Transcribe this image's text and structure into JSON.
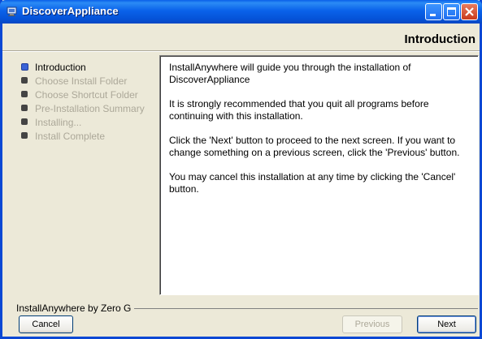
{
  "window": {
    "title": "DiscoverAppliance"
  },
  "page": {
    "heading": "Introduction"
  },
  "steps": [
    {
      "label": "Introduction",
      "active": true
    },
    {
      "label": "Choose Install Folder",
      "active": false
    },
    {
      "label": "Choose Shortcut Folder",
      "active": false
    },
    {
      "label": "Pre-Installation Summary",
      "active": false
    },
    {
      "label": "Installing...",
      "active": false
    },
    {
      "label": "Install Complete",
      "active": false
    }
  ],
  "content": {
    "paragraphs": [
      "InstallAnywhere will guide you through the installation of DiscoverAppliance",
      "It is strongly recommended that you quit all programs before continuing with this installation.",
      "Click the 'Next' button to proceed to the next screen. If you want to change something on a previous screen, click the 'Previous' button.",
      "You may cancel this installation at any time by clicking the 'Cancel' button."
    ]
  },
  "footer": {
    "vendor": "InstallAnywhere by Zero G"
  },
  "buttons": {
    "cancel": "Cancel",
    "previous": "Previous",
    "next": "Next"
  },
  "colors": {
    "titlebar": "#0a62ea",
    "background": "#ece9d8",
    "active_bullet": "#3a63d6",
    "disabled_text": "#aca899"
  }
}
